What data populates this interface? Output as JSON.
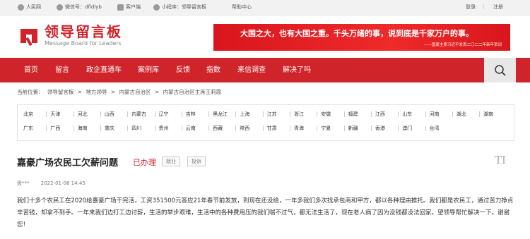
{
  "topbar": {
    "people": "人民网",
    "wechat": "微信号：dfldlyb",
    "client": "客户端",
    "miniprogram": "小程序：领导留言板",
    "help": "帮助中心",
    "login": "登录",
    "divider": "|",
    "register": "注册"
  },
  "logo": {
    "cn": "领导留言板",
    "en": "Message Board for Leaders"
  },
  "banner": {
    "main": "大国之大，也有大国之重。千头万绪的事，说到底是千家万户的事。",
    "sub": "——国家主席习近平发表二〇二二年新年贺词"
  },
  "nav": [
    "首页",
    "留言",
    "政企直通车",
    "案例库",
    "反馈",
    "指数",
    "来信调查",
    "解决了吗"
  ],
  "breadcrumb": [
    "当前位置：",
    "领导留言板",
    ">",
    "地方领导",
    ">",
    "内蒙古自治区",
    ">",
    "内蒙古自治区主席王莉霞"
  ],
  "regions": [
    [
      "北京",
      "天津",
      "河北",
      "山西",
      "内蒙古",
      "辽宁",
      "吉林",
      "黑龙江",
      "上海",
      "江苏",
      "浙江",
      "安徽",
      "福建",
      "江西",
      "山东",
      "河南",
      "湖北",
      "湖南"
    ],
    [
      "广东",
      "广西",
      "海南",
      "重庆",
      "四川",
      "贵州",
      "云南",
      "西藏",
      "陕西",
      "甘肃",
      "青海",
      "宁夏",
      "新疆",
      "香港",
      "澳门",
      "台湾"
    ]
  ],
  "message": {
    "title": "嘉豪广场农民工欠薪问题",
    "status": "已办理",
    "tag1": "就业",
    "tag2": "投诉",
    "font_toggle": "TI",
    "author": "盘***",
    "date": "2022-01-06 14:45",
    "body": "我们十多个农民工在2020给嘉豪广场干完活，工资351500元答应21年春节前发放，到现在还没给，一年多我们多次找承包商和甲方，都以各种理由推托。我们都是农民工，通过苦力挣点辛苦钱，却拿不到手。一年来我们边打工边讨薪，生活的举步艰难，生活中的各种费用压的我们喘不过气，都无法生活了，现在老人病了因为没钱都没法回家。望领导帮忙解决一下。谢谢您！"
  },
  "colors": {
    "brand_red": "#d0242b",
    "banner_red": "#e8242a"
  },
  "icons": [
    "people-icon",
    "wechat-icon",
    "phone-icon",
    "miniprogram-icon",
    "search-icon",
    "logo-icon",
    "font-size-icon"
  ]
}
